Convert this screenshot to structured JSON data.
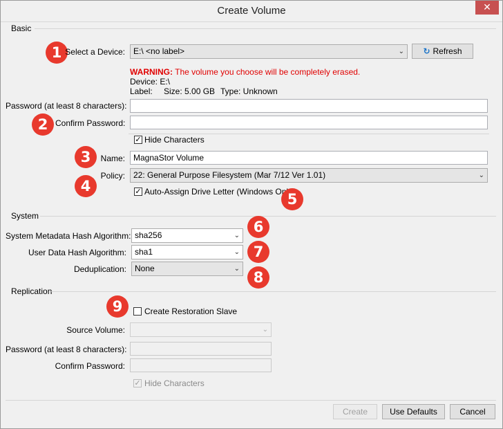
{
  "window": {
    "title": "Create Volume",
    "close_glyph": "✕"
  },
  "basic": {
    "section_label": "Basic",
    "device_label": "Select a Device:",
    "device_value": "E:\\ <no label>",
    "refresh_label": "Refresh",
    "warning_prefix": "WARNING:",
    "warning_text": " The volume you choose will be completely erased.",
    "device_info": "Device: E:\\",
    "label_info": "Label:",
    "size_info": "Size: 5.00 GB",
    "type_info": "Type: Unknown",
    "password_label": "Password (at least 8 characters):",
    "password_value": "",
    "confirm_label": "Confirm Password:",
    "confirm_value": "",
    "hide_chars_label": "Hide Characters",
    "hide_chars_checked": true,
    "name_label": "Name:",
    "name_value": "MagnaStor Volume",
    "policy_label": "Policy:",
    "policy_value": "22: General Purpose Filesystem (Mar 7/12 Ver 1.01)",
    "auto_assign_label": "Auto-Assign Drive Letter (Windows Only)",
    "auto_assign_checked": true
  },
  "system": {
    "section_label": "System",
    "metadata_hash_label": "System Metadata Hash Algorithm:",
    "metadata_hash_value": "sha256",
    "user_hash_label": "User Data Hash Algorithm:",
    "user_hash_value": "sha1",
    "dedup_label": "Deduplication:",
    "dedup_value": "None"
  },
  "replication": {
    "section_label": "Replication",
    "restoration_label": "Create Restoration Slave",
    "restoration_checked": false,
    "source_label": "Source Volume:",
    "source_value": "",
    "password_label": "Password (at least 8 characters):",
    "confirm_label": "Confirm Password:",
    "hide_chars_label": "Hide Characters",
    "hide_chars_checked": true
  },
  "footer": {
    "create_label": "Create",
    "defaults_label": "Use Defaults",
    "cancel_label": "Cancel"
  },
  "badges": [
    "1",
    "2",
    "3",
    "4",
    "5",
    "6",
    "7",
    "8",
    "9"
  ],
  "icons": {
    "chevron": "chevron-down-icon",
    "refresh": "refresh-icon",
    "check": "checkmark-icon"
  },
  "colors": {
    "badge": "#e8392d",
    "warning": "#e00000",
    "close": "#c75050",
    "refresh_icon": "#1a73c8"
  }
}
